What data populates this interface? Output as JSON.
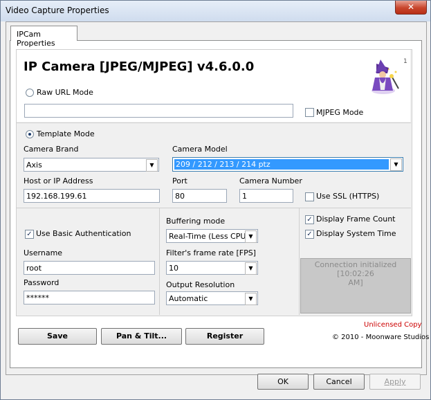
{
  "window": {
    "title": "Video Capture Properties",
    "close_glyph": "✕"
  },
  "tabs": [
    {
      "label": "IPCam Properties"
    }
  ],
  "header": {
    "title": "IP Camera [JPEG/MJPEG] v4.6.0.0",
    "corner_number": "1",
    "logo_icon": "wizard-icon"
  },
  "raw_url": {
    "label": "Raw URL Mode",
    "selected": false,
    "url_value": "",
    "mjpeg_label": "MJPEG Mode",
    "mjpeg_checked": false
  },
  "template": {
    "label": "Template Mode",
    "selected": true,
    "brand_label": "Camera Brand",
    "brand_value": "Axis",
    "model_label": "Camera Model",
    "model_value": "209 / 212 / 213 / 214 ptz",
    "host_label": "Host or IP Address",
    "host_value": "192.168.199.61",
    "port_label": "Port",
    "port_value": "80",
    "camnum_label": "Camera Number",
    "camnum_value": "1",
    "ssl_label": "Use SSL (HTTPS)",
    "ssl_checked": false
  },
  "auth": {
    "basic_label": "Use Basic Authentication",
    "basic_checked": true,
    "username_label": "Username",
    "username_value": "root",
    "password_label": "Password",
    "password_value": "******"
  },
  "buffering": {
    "mode_label": "Buffering mode",
    "mode_value": "Real-Time (Less CPU)",
    "fps_label": "Filter's frame rate [FPS]",
    "fps_value": "10",
    "res_label": "Output Resolution",
    "res_value": "Automatic"
  },
  "display": {
    "frame_count_label": "Display Frame Count",
    "frame_count_checked": true,
    "system_time_label": "Display System Time",
    "system_time_checked": true,
    "status_line1": "Connection initialized [10:02:26",
    "status_line2": "AM]"
  },
  "actions": {
    "save": "Save",
    "pan_tilt": "Pan & Tilt...",
    "register": "Register"
  },
  "footer": {
    "unlicensed": "Unlicensed Copy",
    "copyright": "© 2010 - Moonware Studios"
  },
  "dialog_buttons": {
    "ok": "OK",
    "cancel": "Cancel",
    "apply": "Apply"
  },
  "colors": {
    "unlicensed": "#cc0000",
    "selection": "#3399ff",
    "status_bg": "#c8c8c8",
    "status_text": "#8a8a8a"
  }
}
